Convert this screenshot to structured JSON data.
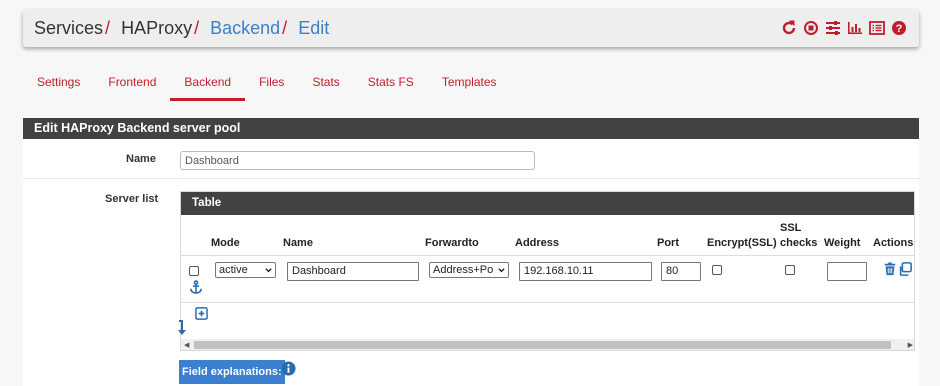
{
  "breadcrumb": {
    "items": [
      {
        "label": "Services",
        "link": false
      },
      {
        "label": "HAProxy",
        "link": false
      },
      {
        "label": "Backend",
        "link": true
      },
      {
        "label": "Edit",
        "link": true
      }
    ],
    "separator": "/"
  },
  "header_icons": [
    "reload-icon",
    "stop-circle-icon",
    "sliders-icon",
    "bar-chart-icon",
    "list-icon",
    "help-icon"
  ],
  "tabs": [
    {
      "label": "Settings",
      "active": false
    },
    {
      "label": "Frontend",
      "active": false
    },
    {
      "label": "Backend",
      "active": true
    },
    {
      "label": "Files",
      "active": false
    },
    {
      "label": "Stats",
      "active": false
    },
    {
      "label": "Stats FS",
      "active": false
    },
    {
      "label": "Templates",
      "active": false
    }
  ],
  "panel": {
    "title": "Edit HAProxy Backend server pool",
    "name_label": "Name",
    "name_value": "Dashboard",
    "server_list_label": "Server list",
    "table": {
      "title": "Table",
      "columns": {
        "mode": "Mode",
        "name": "Name",
        "forwardto": "Forwardto",
        "address": "Address",
        "port": "Port",
        "encrypt": "Encrypt(SSL)",
        "ssl_checks_1": "SSL",
        "ssl_checks_2": "checks",
        "weight": "Weight",
        "actions": "Actions"
      },
      "row": {
        "mode": "active",
        "name": "Dashboard",
        "forwardto": "Address+Po",
        "address": "192.168.10.11",
        "port": "80",
        "weight": ""
      }
    },
    "field_explanations": "Field explanations:"
  },
  "colors": {
    "accent_red": "#bf1e2e",
    "link_blue": "#3b7fc4",
    "header_dark": "#424242",
    "button_blue": "#3b7fd0"
  }
}
